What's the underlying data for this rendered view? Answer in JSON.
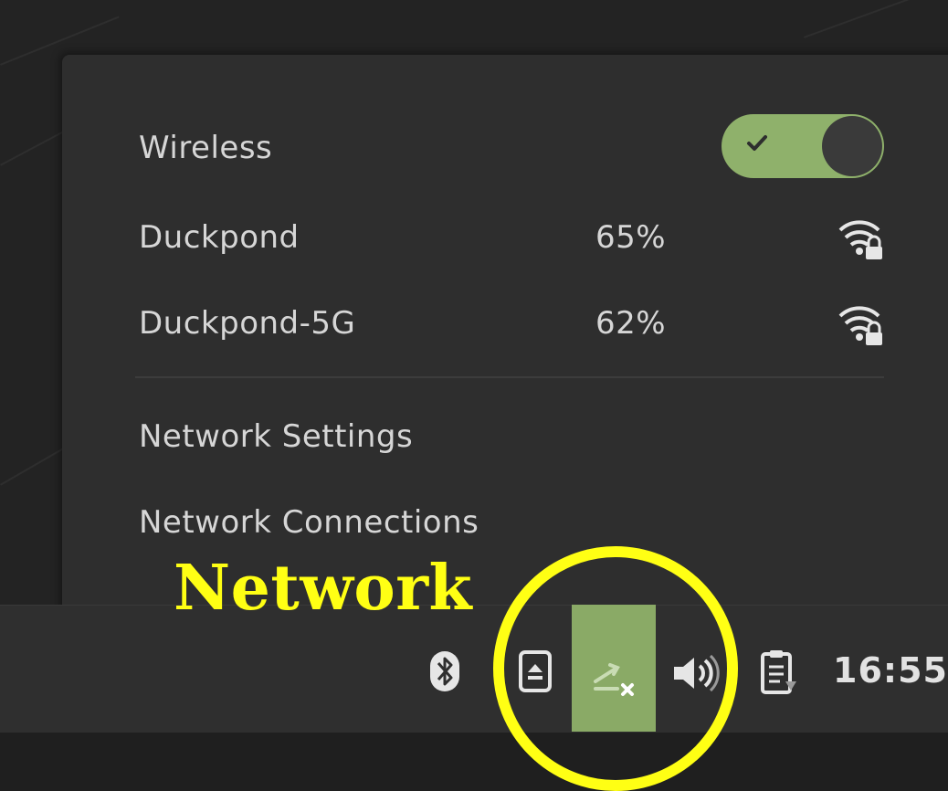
{
  "network_menu": {
    "wireless": {
      "label": "Wireless",
      "enabled": true
    },
    "networks": [
      {
        "name": "Duckpond",
        "signal": "65%",
        "icon": "wifi-secured-icon"
      },
      {
        "name": "Duckpond-5G",
        "signal": "62%",
        "icon": "wifi-secured-icon"
      }
    ],
    "actions": [
      {
        "label": "Network Settings"
      },
      {
        "label": "Network Connections"
      }
    ]
  },
  "panel": {
    "tray_icons": [
      "bluetooth-icon",
      "removable-drive-icon",
      "network-disconnected-icon",
      "volume-icon",
      "clipboard-icon"
    ],
    "clock": "16:55"
  },
  "annotation": {
    "label": "Network",
    "color": "#ffff14"
  },
  "colors": {
    "accent": "#8fb16b",
    "menu_bg": "#2e2e2e",
    "panel_bg": "#2f2f2f",
    "text": "#d6d6d6"
  }
}
